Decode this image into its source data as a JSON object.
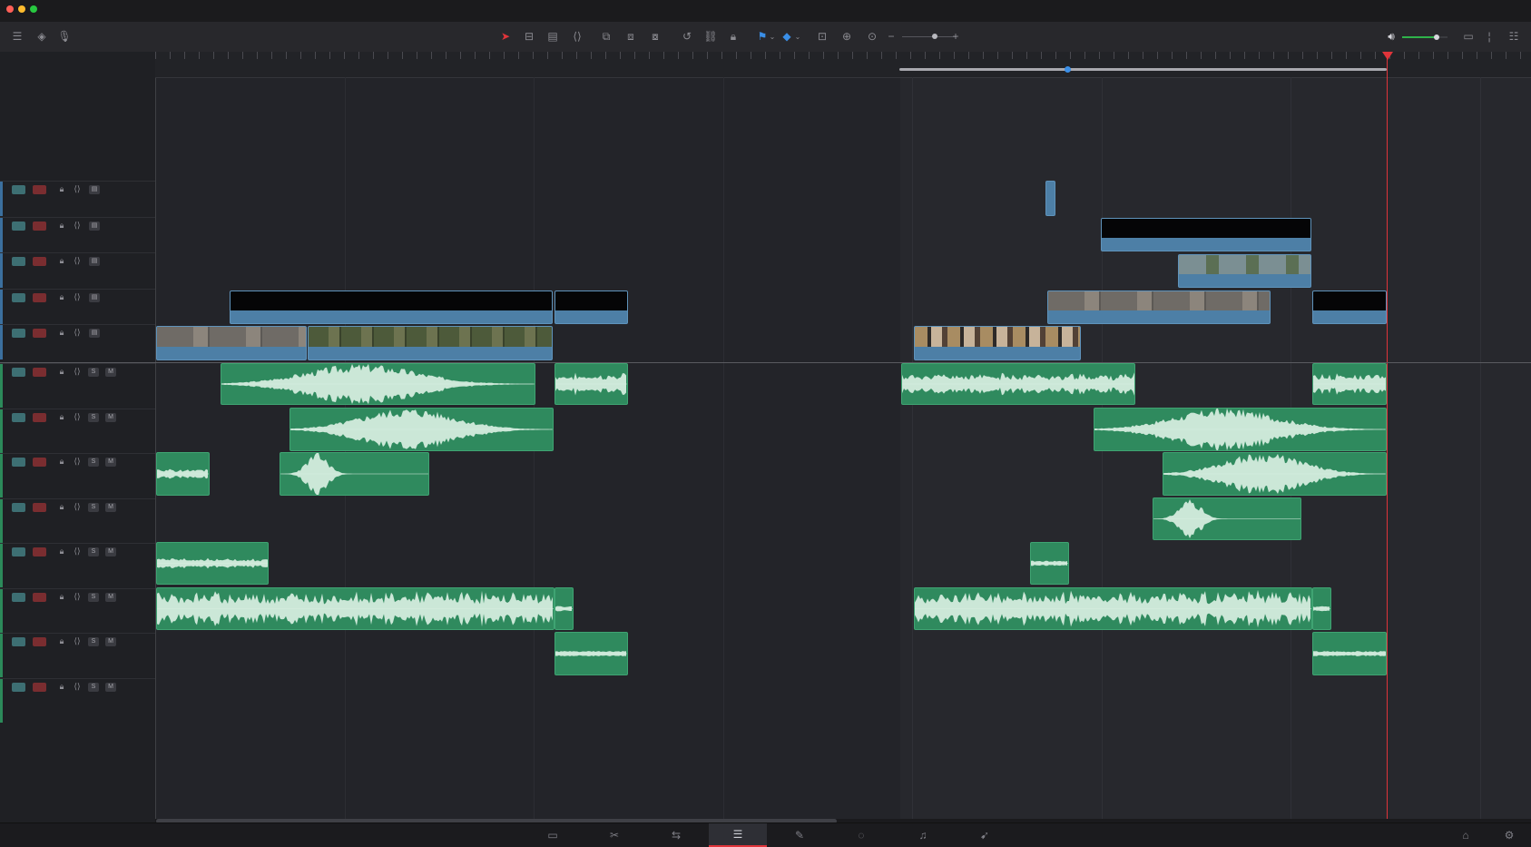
{
  "window": {
    "traffic_lights": [
      {
        "name": "close",
        "color": "#ff5f57"
      },
      {
        "name": "minimize",
        "color": "#febc2e"
      },
      {
        "name": "zoom",
        "color": "#28c840"
      }
    ]
  },
  "toolbar": {
    "left_tools": [
      "timeline-view-options-icon",
      "snap-icon",
      "microphone-icon"
    ],
    "edit_tools": [
      "selection-mode-icon",
      "trim-edit-mode-icon",
      "dynamic-trim-icon",
      "blade-edit-icon",
      "insert-clip-icon",
      "overwrite-clip-icon",
      "replace-clip-icon",
      "snapping-icon",
      "linked-selection-icon",
      "position-lock-icon",
      "flag-icon",
      "marker-icon",
      "full-extent-zoom-icon",
      "detail-zoom-icon",
      "custom-zoom-icon"
    ],
    "zoom_minus": "−",
    "zoom_plus": "+",
    "zoom_level": 0.6,
    "volume_level": 0.75,
    "accent_color": "#e0343a",
    "volume_color": "#2fb24a"
  },
  "video_tracks": [
    {
      "id": "V5"
    },
    {
      "id": "V4"
    },
    {
      "id": "V3"
    },
    {
      "id": "V2"
    },
    {
      "id": "V1"
    }
  ],
  "audio_tracks": [
    {
      "id": "A1",
      "solo": "S",
      "mute": "M"
    },
    {
      "id": "A2",
      "solo": "S",
      "mute": "M"
    },
    {
      "id": "A3",
      "solo": "S",
      "mute": "M"
    },
    {
      "id": "A4",
      "solo": "S",
      "mute": "M"
    },
    {
      "id": "A5",
      "solo": "S",
      "mute": "M"
    },
    {
      "id": "A6",
      "solo": "S",
      "mute": "M"
    },
    {
      "id": "A7",
      "solo": "S",
      "mute": "M"
    },
    {
      "id": "A8",
      "solo": "S",
      "mute": "M"
    }
  ],
  "colors": {
    "video_clip": "#4d7fa6",
    "audio_clip": "#2f8a5e",
    "waveform": "#d9efe2",
    "playhead": "#e0343a",
    "enable_button": "#3d6f73",
    "record_button": "#7a2d30"
  },
  "pages": [
    {
      "name": "media-page-icon",
      "glyph": "▭"
    },
    {
      "name": "cut-page-icon",
      "glyph": "✂"
    },
    {
      "name": "edit-page-icon",
      "glyph": "⇆"
    },
    {
      "name": "timeline-page-icon",
      "glyph": "☰",
      "active": true
    },
    {
      "name": "fusion-page-icon",
      "glyph": "✎"
    },
    {
      "name": "color-page-icon",
      "glyph": "◌"
    },
    {
      "name": "fairlight-page-icon",
      "glyph": "♫"
    },
    {
      "name": "deliver-page-icon",
      "glyph": "➹"
    }
  ],
  "status_icons": [
    "home-icon",
    "settings-icon"
  ]
}
